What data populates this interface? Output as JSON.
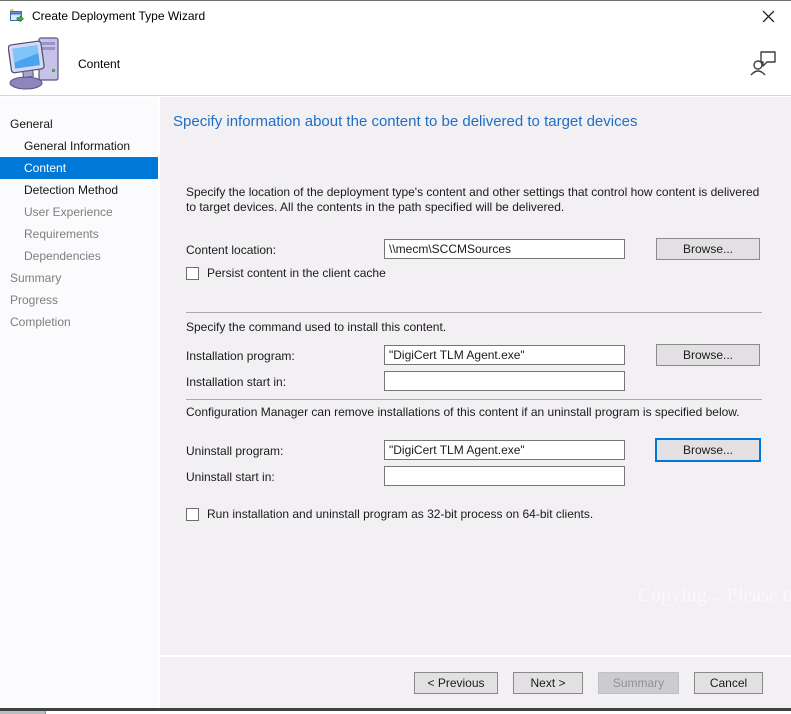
{
  "window": {
    "title": "Create Deployment Type Wizard"
  },
  "header": {
    "page_label": "Content"
  },
  "sidebar": {
    "items": [
      {
        "label": "General",
        "level": 0,
        "state": "enabled"
      },
      {
        "label": "General Information",
        "level": 1,
        "state": "enabled"
      },
      {
        "label": "Content",
        "level": 1,
        "state": "selected"
      },
      {
        "label": "Detection Method",
        "level": 1,
        "state": "enabled"
      },
      {
        "label": "User Experience",
        "level": 1,
        "state": "disabled"
      },
      {
        "label": "Requirements",
        "level": 1,
        "state": "disabled"
      },
      {
        "label": "Dependencies",
        "level": 1,
        "state": "disabled"
      },
      {
        "label": "Summary",
        "level": 0,
        "state": "disabled"
      },
      {
        "label": "Progress",
        "level": 0,
        "state": "disabled"
      },
      {
        "label": "Completion",
        "level": 0,
        "state": "disabled"
      }
    ]
  },
  "main": {
    "heading": "Specify information about the content to be delivered to target devices",
    "intro": "Specify the location of the deployment type's content and other settings that control how content is delivered to target devices. All the contents in the path specified will be delivered.",
    "content_location": {
      "label": "Content location:",
      "value": "\\\\mecm\\SCCMSources",
      "browse_label": "Browse..."
    },
    "persist_checkbox": {
      "label": "Persist content in the client cache",
      "checked": false
    },
    "install_section_text": "Specify the command used to install this content.",
    "installation_program": {
      "label": "Installation program:",
      "value": "\"DigiCert TLM Agent.exe\"",
      "browse_label": "Browse..."
    },
    "installation_start_in": {
      "label": "Installation start in:",
      "value": ""
    },
    "uninstall_section_text": "Configuration Manager can remove installations of this content if an uninstall program is specified below.",
    "uninstall_program": {
      "label": "Uninstall program:",
      "value": "\"DigiCert TLM Agent.exe\"",
      "browse_label": "Browse..."
    },
    "uninstall_start_in": {
      "label": "Uninstall start in:",
      "value": ""
    },
    "bitness_checkbox": {
      "label": "Run installation and uninstall program as 32-bit process on 64-bit clients.",
      "checked": false
    },
    "watermark": "Copying... Please try"
  },
  "footer": {
    "buttons": [
      {
        "label": "< Previous",
        "state": "enabled"
      },
      {
        "label": "Next >",
        "state": "enabled"
      },
      {
        "label": "Summary",
        "state": "disabled"
      },
      {
        "label": "Cancel",
        "state": "enabled"
      }
    ]
  },
  "colors": {
    "accent": "#0078d7",
    "heading_blue": "#1f6fc4",
    "disabled_text": "#7f7f7f"
  }
}
